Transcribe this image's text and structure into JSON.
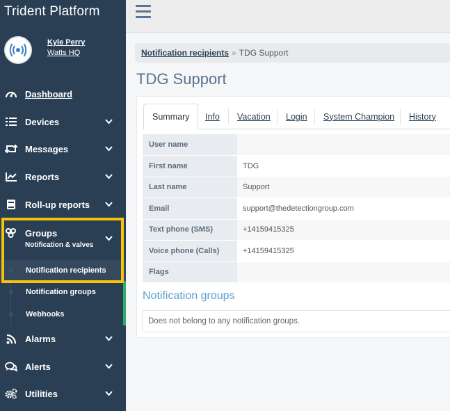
{
  "app": {
    "title": "Trident Platform"
  },
  "profile": {
    "name": "Kyle Perry",
    "org": "Watts HQ"
  },
  "sidebar": {
    "items": [
      {
        "label": "Dashboard",
        "icon": "speedometer-icon"
      },
      {
        "label": "Devices",
        "icon": "list-icon"
      },
      {
        "label": "Messages",
        "icon": "retweet-icon"
      },
      {
        "label": "Reports",
        "icon": "line-chart-icon"
      },
      {
        "label": "Roll-up reports",
        "icon": "book-icon"
      },
      {
        "label": "Groups",
        "sublabel": "Notification & valves",
        "icon": "users-icon"
      },
      {
        "label": "Alarms",
        "icon": "rss-icon"
      },
      {
        "label": "Alerts",
        "icon": "comments-icon"
      },
      {
        "label": "Utilities",
        "icon": "gears-icon"
      }
    ],
    "group_sub_items": [
      {
        "label": "Notification recipients"
      },
      {
        "label": "Notification groups"
      },
      {
        "label": "Webhooks"
      }
    ]
  },
  "breadcrumb": {
    "parent": "Notification recipients",
    "separator": "»",
    "current": "TDG Support"
  },
  "page": {
    "title": "TDG Support"
  },
  "tabs": [
    {
      "label": "Summary"
    },
    {
      "label": "Info"
    },
    {
      "label": "Vacation"
    },
    {
      "label": "Login"
    },
    {
      "label": "System Champion"
    },
    {
      "label": "History"
    }
  ],
  "details": [
    {
      "key": "User name",
      "value": ""
    },
    {
      "key": "First name",
      "value": "TDG"
    },
    {
      "key": "Last name",
      "value": "Support"
    },
    {
      "key": "Email",
      "value": "support@thedetectiongroup.com"
    },
    {
      "key": "Text phone (SMS)",
      "value": "+14159415325"
    },
    {
      "key": "Voice phone (Calls)",
      "value": "+14159415325"
    },
    {
      "key": "Flags",
      "value": ""
    }
  ],
  "notification_groups": {
    "title": "Notification groups",
    "empty_text": "Does not belong to any notification groups."
  },
  "colors": {
    "sidebar": "#2a3f54",
    "highlight": "#f6c20b",
    "accent": "#5aa1d6"
  }
}
